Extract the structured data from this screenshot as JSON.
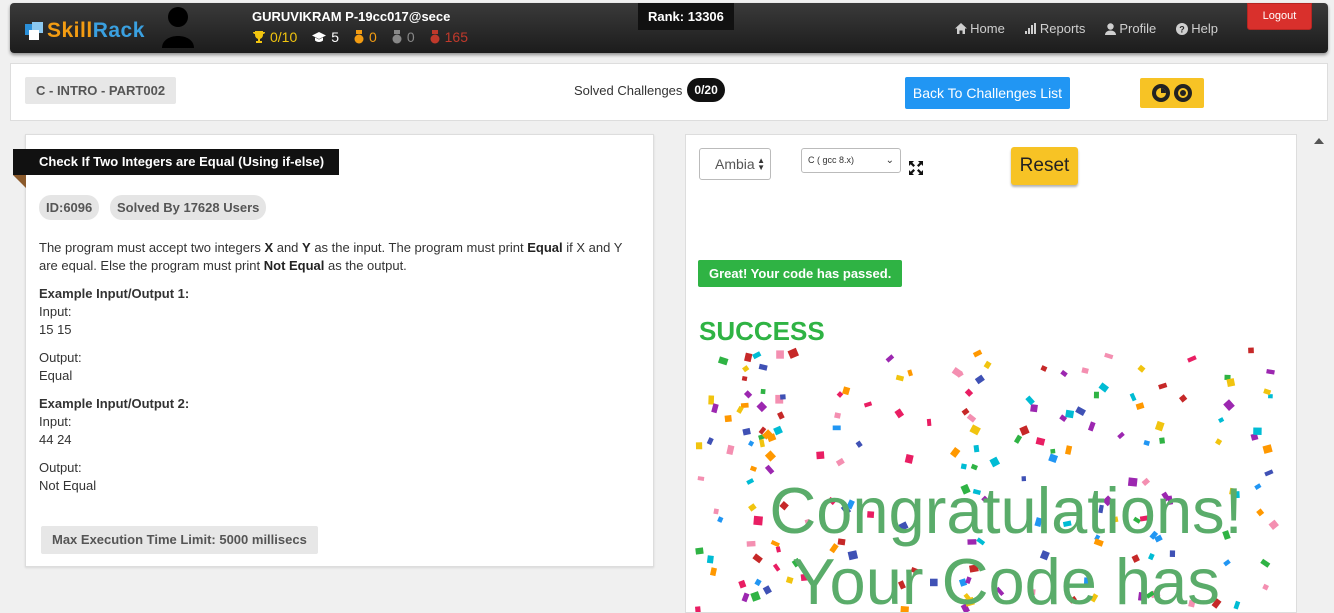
{
  "navbar": {
    "logo": {
      "part1": "Skill",
      "part2": "Rack"
    },
    "user_name": "GURUVIKRAM P-19cc017@sece",
    "stats": {
      "trophy": "0/10",
      "cap": "5",
      "gold": "0",
      "silver": "0",
      "red": "165"
    },
    "rank": "Rank: 13306",
    "links": {
      "home": "Home",
      "reports": "Reports",
      "profile": "Profile",
      "help": "Help"
    },
    "logout": "Logout"
  },
  "subheader": {
    "course": "C - INTRO - PART002",
    "solved_label": "Solved Challenges",
    "solved_count": "0/20",
    "back_button": "Back To Challenges List"
  },
  "problem": {
    "title": "Check If Two Integers are Equal (Using if-else)",
    "id": "ID:6096",
    "solved_by": "Solved By 17628 Users",
    "desc_1": "The program must accept two integers ",
    "var_x": "X",
    "desc_and": " and ",
    "var_y": "Y",
    "desc_2": " as the input. The program must print ",
    "equal_word": "Equal",
    "desc_3": " if X and Y are equal. Else the program must print ",
    "not_equal_word": "Not Equal",
    "desc_4": " as the output.",
    "examples": [
      {
        "title": "Example Input/Output 1:",
        "input_label": "Input:",
        "input": "15 15",
        "output_label": "Output:",
        "output": "Equal"
      },
      {
        "title": "Example Input/Output 2:",
        "input_label": "Input:",
        "input": "44 24",
        "output_label": "Output:",
        "output": "Not Equal"
      }
    ],
    "max_exec": "Max Execution Time Limit: 5000 millisecs"
  },
  "editor": {
    "theme": "Ambia",
    "language": "C ( gcc 8.x)",
    "reset": "Reset",
    "passed_msg": "Great! Your code has passed.",
    "success": "SUCCESS",
    "congrats_line1": "Congratulations!",
    "congrats_line2": "Your Code has"
  },
  "colors": {
    "brand_orange": "#f39c12",
    "brand_blue": "#3aa0e0",
    "success_green": "#2fb344",
    "reset_yellow": "#f7c325",
    "back_blue": "#2196f3",
    "logout_red": "#d9302c"
  }
}
